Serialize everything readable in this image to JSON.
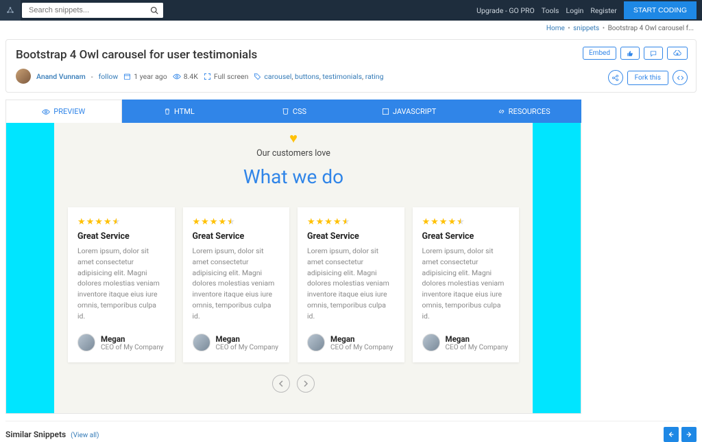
{
  "nav": {
    "search_placeholder": "Search snippets...",
    "links": [
      "Upgrade - GO PRO",
      "Tools",
      "Login",
      "Register"
    ],
    "start_btn": "START CODING"
  },
  "breadcrumb": {
    "home": "Home",
    "snippets": "snippets",
    "current": "Bootstrap 4 Owl carousel f..."
  },
  "header": {
    "title": "Bootstrap 4 Owl carousel for user testimonials",
    "author": "Anand Vunnam",
    "follow": "follow",
    "time": "1 year ago",
    "views": "8.4K",
    "fullscreen": "Full screen",
    "tags": [
      "carousel",
      "buttons",
      "testimonials",
      "rating"
    ],
    "embed": "Embed",
    "fork": "Fork this"
  },
  "tabs": {
    "preview": "PREVIEW",
    "html": "HTML",
    "css": "CSS",
    "js": "JAVASCRIPT",
    "res": "RESOURCES"
  },
  "preview": {
    "subtitle": "Our customers love",
    "title": "What we do",
    "cards": [
      {
        "title": "Great Service",
        "body": "Lorem ipsum, dolor sit amet consectetur adipisicing elit. Magni dolores molestias veniam inventore itaque eius iure omnis, temporibus culpa id.",
        "name": "Megan",
        "role": "CEO of My Company"
      },
      {
        "title": "Great Service",
        "body": "Lorem ipsum, dolor sit amet consectetur adipisicing elit. Magni dolores molestias veniam inventore itaque eius iure omnis, temporibus culpa id.",
        "name": "Megan",
        "role": "CEO of My Company"
      },
      {
        "title": "Great Service",
        "body": "Lorem ipsum, dolor sit amet consectetur adipisicing elit. Magni dolores molestias veniam inventore itaque eius iure omnis, temporibus culpa id.",
        "name": "Megan",
        "role": "CEO of My Company"
      },
      {
        "title": "Great Service",
        "body": "Lorem ipsum, dolor sit amet consectetur adipisicing elit. Magni dolores molestias veniam inventore itaque eius iure omnis, temporibus culpa id.",
        "name": "Megan",
        "role": "CEO of My Company"
      }
    ]
  },
  "similar": {
    "title": "Similar Snippets",
    "viewall": "(View all)"
  }
}
